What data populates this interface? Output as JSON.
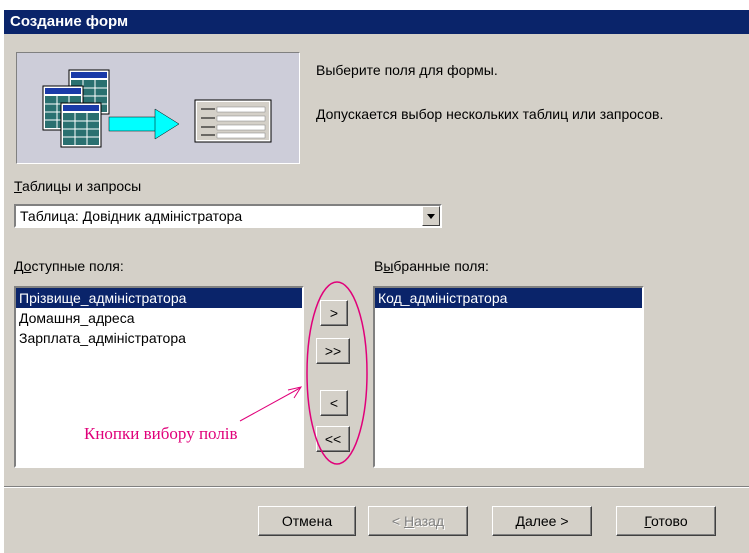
{
  "window": {
    "title": "Создание форм"
  },
  "description": {
    "line1": "Выберите поля для формы.",
    "line2": "Допускается выбор нескольких таблиц или запросов."
  },
  "tables": {
    "label_underline": "Т",
    "label_rest": "аблицы и запросы",
    "selected": "Таблица: Довідник адміністратора"
  },
  "available": {
    "label_pre": "Д",
    "label_u": "о",
    "label_post": "ступные поля:",
    "items": [
      "Прізвище_адміністратора",
      "Домашня_адреса",
      "Зарплата_адміністратора"
    ]
  },
  "selected_fields": {
    "label_pre": "В",
    "label_u": "ы",
    "label_post": "бранные поля:",
    "items": [
      "Код_адміністратора"
    ]
  },
  "move_buttons": {
    "add_one": ">",
    "add_all": ">>",
    "remove_one": "<",
    "remove_all": "<<"
  },
  "annotation": "Кнопки вибору полів",
  "footer": {
    "cancel": "Отмена",
    "back_pre": "< ",
    "back_u": "Н",
    "back_post": "азад",
    "next_u": "Д",
    "next_post": "алее >",
    "finish_u": "Г",
    "finish_post": "отово"
  },
  "colors": {
    "title_bar": "#0a246a",
    "dialog": "#d4d0c8",
    "selection": "#0a246a",
    "annotation": "#e0007a",
    "arrow": "#00ffff"
  }
}
